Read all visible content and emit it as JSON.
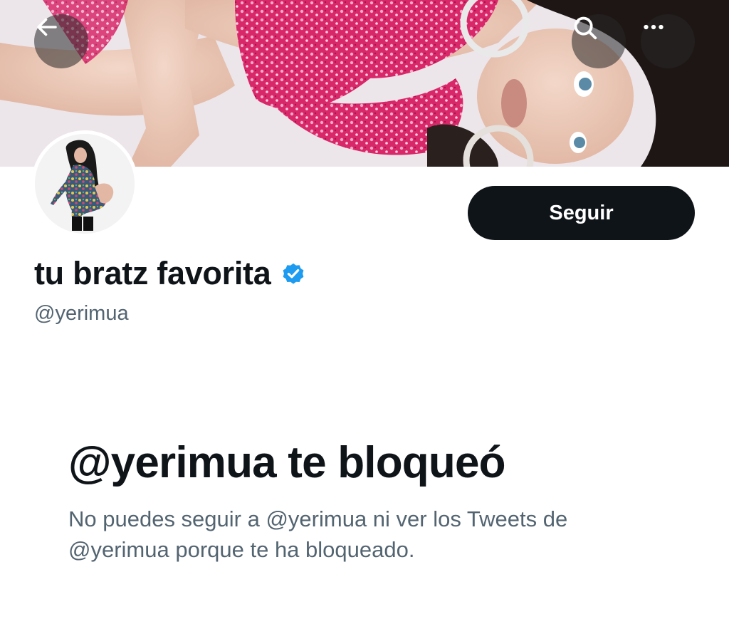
{
  "profile": {
    "display_name": "tu bratz favorita",
    "handle": "@yerimua",
    "verified": true
  },
  "header": {
    "back_icon": "arrow-left-icon",
    "search_icon": "search-icon",
    "more_icon": "more-horizontal-icon"
  },
  "actions": {
    "follow_label": "Seguir"
  },
  "blocked": {
    "title": "@yerimua te bloqueó",
    "description": "No puedes seguir a @yerimua ni ver los Tweets de @yerimua porque te ha bloqueado."
  },
  "colors": {
    "primary_text": "#0f1419",
    "secondary_text": "#536471",
    "verified_blue": "#1d9bf0",
    "button_bg": "#0f1419",
    "button_text": "#ffffff"
  }
}
